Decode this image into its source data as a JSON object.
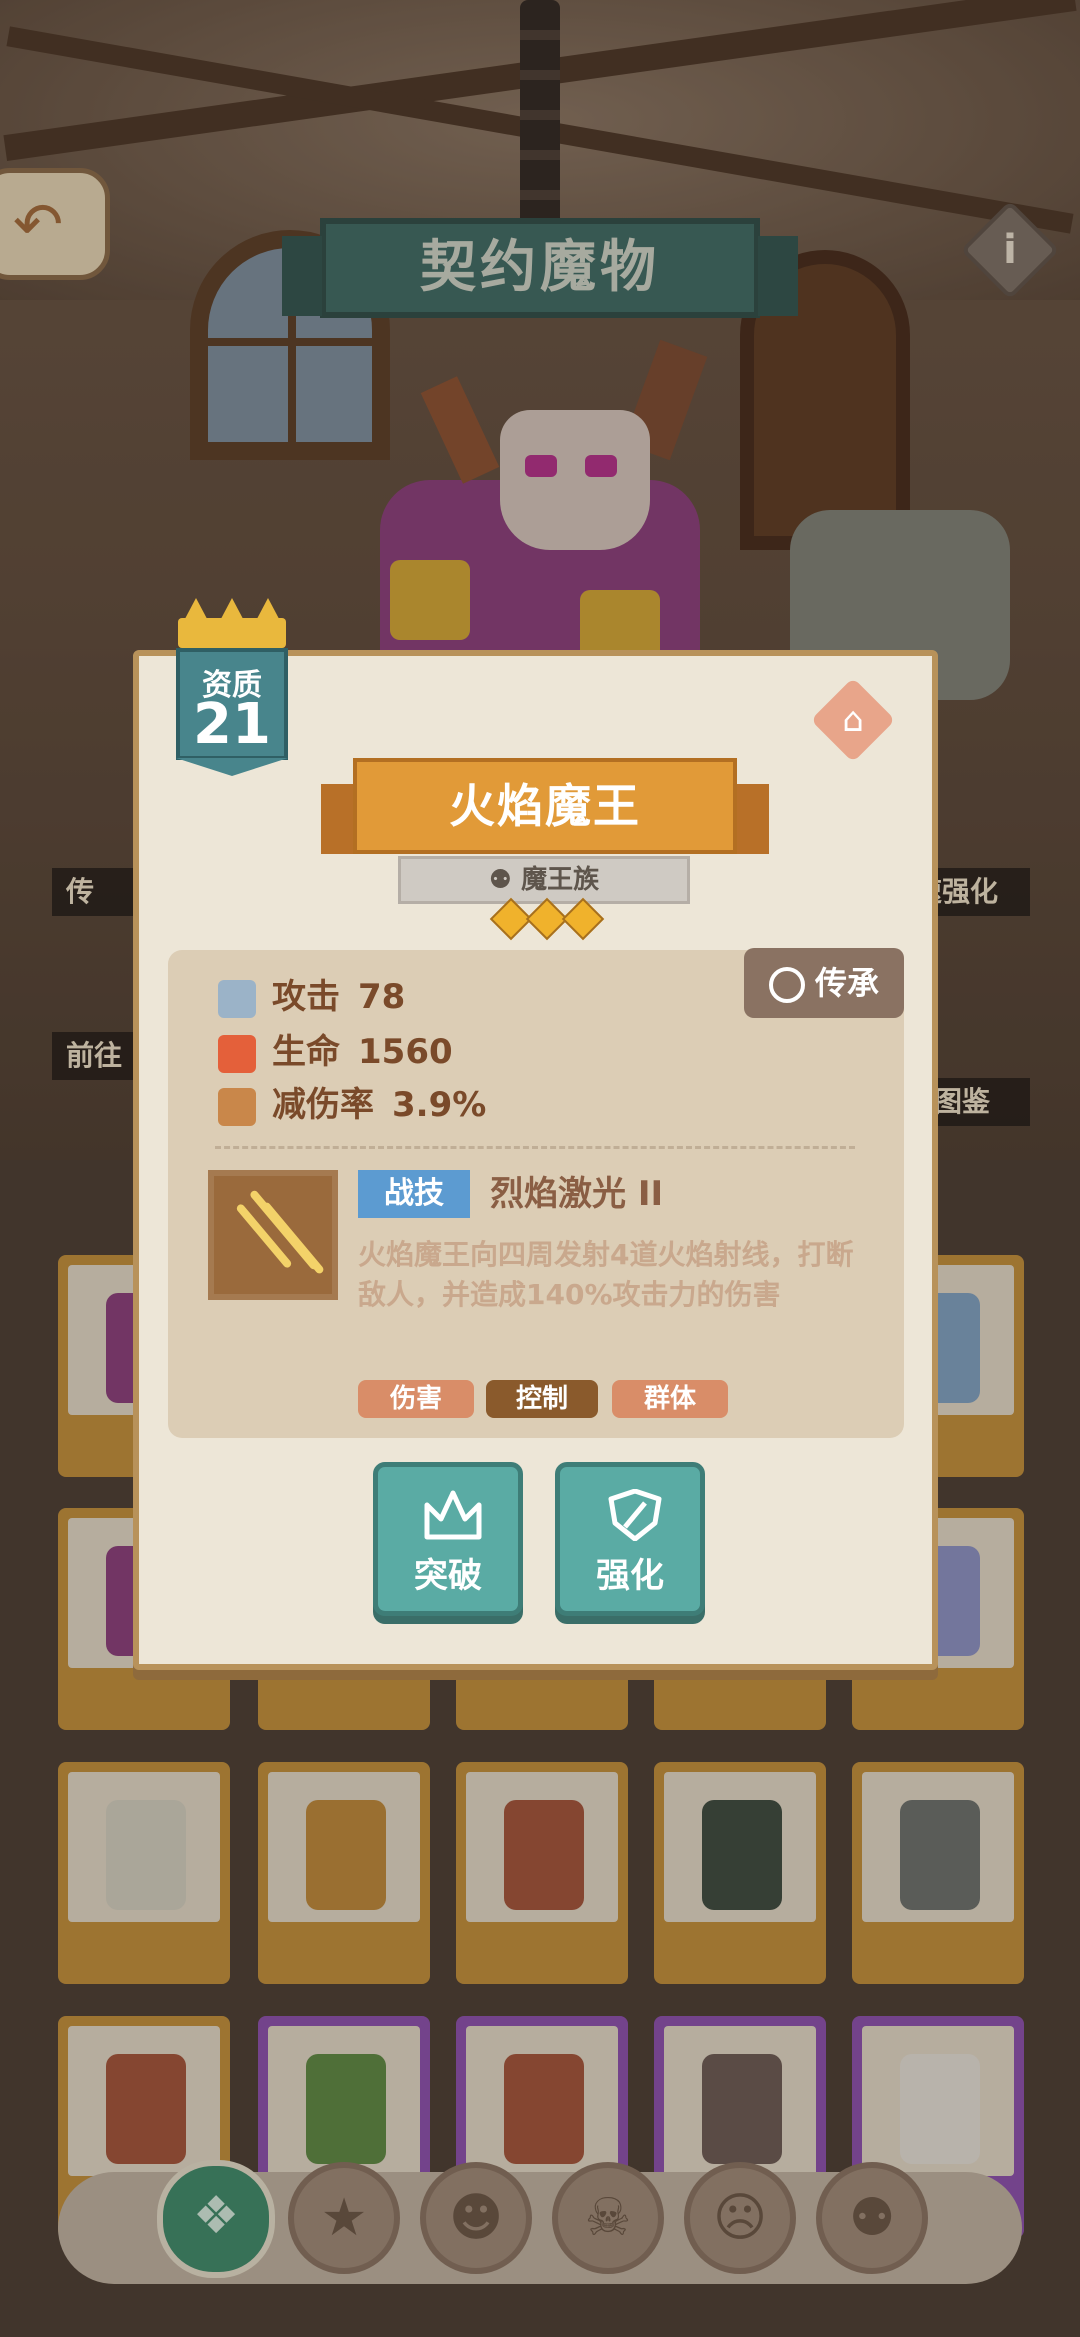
{
  "header": {
    "title": "契约魔物"
  },
  "side_buttons": {
    "left_top": "传",
    "left_bottom": "前往",
    "right_top": "速强化",
    "right_bottom": "图鉴"
  },
  "monster": {
    "grade_label": "资质",
    "grade_value": "21",
    "name": "火焰魔王",
    "race": "魔王族",
    "stars": 3
  },
  "stats": [
    {
      "label": "攻击",
      "value": "78",
      "icon": "sword-icon"
    },
    {
      "label": "生命",
      "value": "1560",
      "icon": "heart-icon"
    },
    {
      "label": "减伤率",
      "value": "3.9%",
      "icon": "shield-icon"
    }
  ],
  "inherit_label": "传承",
  "skill": {
    "type": "战技",
    "name": "烈焰激光 II",
    "description": "火焰魔王向四周发射4道火焰射线，打断敌人，并造成140%攻击力的伤害",
    "tags": [
      "伤害",
      "控制",
      "群体"
    ]
  },
  "actions": {
    "breakthrough": "突破",
    "enhance": "强化"
  },
  "tabs": [
    "all-icon",
    "egg-icon",
    "orc-icon",
    "skull-icon",
    "demon-icon",
    "devil-icon"
  ],
  "colors": {
    "teal": "#3d6b66",
    "orange": "#e19a38",
    "gold": "#c4913a",
    "action": "#5aaba4"
  }
}
